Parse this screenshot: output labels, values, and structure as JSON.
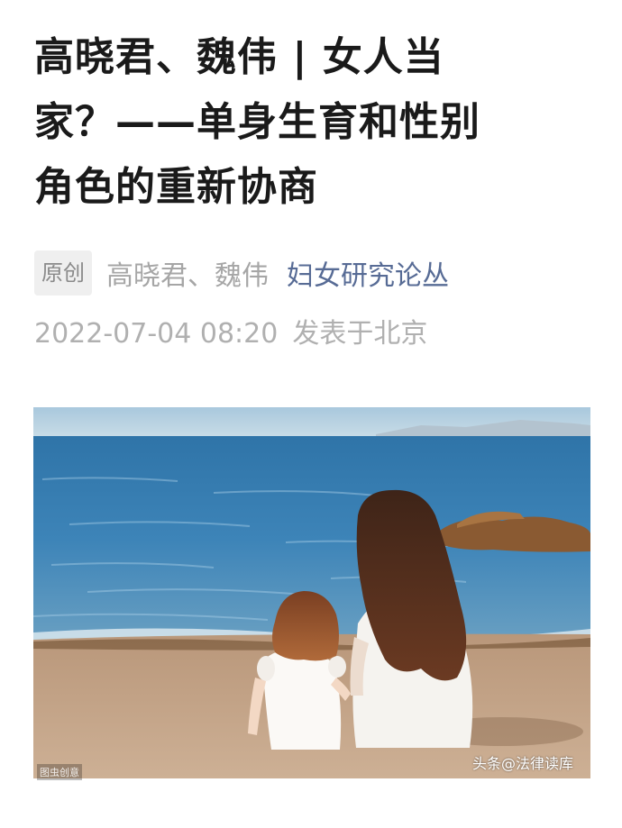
{
  "article": {
    "title_lines": [
      "高晓君、魏伟 | 女人当",
      "家？——单身生育和性别",
      "角色的重新协商"
    ],
    "original_tag": "原创",
    "author": "高晓君、魏伟",
    "account_name": "妇女研究论丛",
    "publish_time": "2022-07-04 08:20",
    "location": "发表于北京"
  },
  "cover_image": {
    "watermark_left": "图虫创意",
    "watermark_right": "头条@法律读库"
  },
  "colors": {
    "title": "#1a1a1a",
    "account_link": "#576b95",
    "meta_gray": "#a6a6a6",
    "tag_bg": "#efefef"
  }
}
